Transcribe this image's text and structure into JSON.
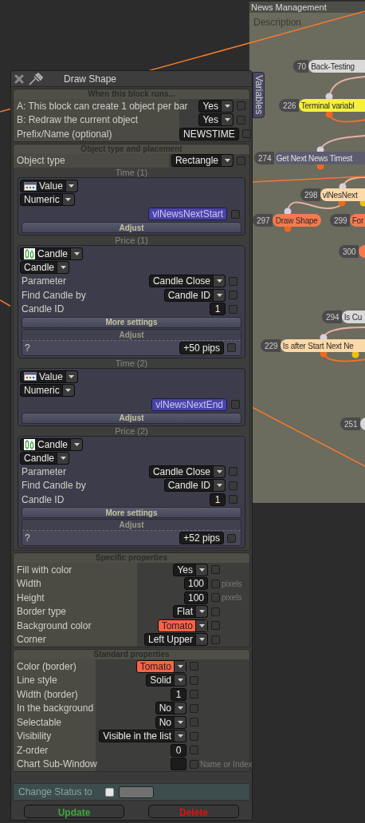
{
  "news_panel": {
    "title": "News Management",
    "description": "Description",
    "side_tab": "Variables",
    "nodes": [
      {
        "id": "70",
        "label": "Back-Testing",
        "color": "#d9d9d9"
      },
      {
        "id": "226",
        "label": "Terminal variabl",
        "color": "#f5f03c"
      },
      {
        "id": "274",
        "label": "Get Next News Timest",
        "color": "#5c5c6e"
      },
      {
        "id": "298",
        "label": "vlNesNext",
        "color": "#fcd9a8"
      },
      {
        "id": "297",
        "label": "Draw Shape",
        "color": "#f57a4f"
      },
      {
        "id": "299",
        "label": "For",
        "color": "#f57a4f"
      },
      {
        "id": "300",
        "color": "#f57a4f"
      },
      {
        "id": "294",
        "label": "Is Cu",
        "color": "#d9d9d9"
      },
      {
        "id": "229",
        "label": "Is after Start Next Ne",
        "color": "#fcd9a8"
      },
      {
        "id": "251",
        "color": "#d9d9d9"
      }
    ]
  },
  "dialog": {
    "title": "Draw Shape",
    "sections": [
      {
        "kind": "runs",
        "title": "When this block runs...",
        "rows": [
          {
            "kind": "dropdown",
            "label": "A: This block can create 1 object per bar",
            "value": "Yes",
            "checked": false
          },
          {
            "kind": "dropdown",
            "label": "B: Redraw the current object",
            "value": "Yes",
            "checked": false
          },
          {
            "kind": "text",
            "label": "Prefix/Name (optional)",
            "value": "NEWSTIME",
            "checked": false
          }
        ]
      },
      {
        "kind": "placement",
        "title": "Object type and placement",
        "rows": [
          {
            "kind": "dropdown",
            "label": "Object type",
            "value": "Rectangle",
            "checked": false
          }
        ],
        "groups": [
          {
            "kind": "value",
            "title": "Time (1)",
            "source": "Value",
            "type": "Numeric",
            "variable": "vlNewsNextStart",
            "checked": false,
            "adjust": "Adjust"
          },
          {
            "kind": "candle",
            "title": "Price (1)",
            "source": "Candle",
            "type": "Candle",
            "rows": [
              {
                "kind": "dropdown",
                "label": "Parameter",
                "value": "Candle Close",
                "checked": false
              },
              {
                "kind": "dropdown",
                "label": "Find Candle by",
                "value": "Candle ID",
                "checked": false
              },
              {
                "kind": "text",
                "label": "Candle ID",
                "value": "1",
                "checked": false
              }
            ],
            "more": "More settings",
            "adjust": "Adjust",
            "adjust_row": {
              "label": "?",
              "value": "+50 pips",
              "checked": false
            }
          },
          {
            "kind": "value",
            "title": "Time (2)",
            "source": "Value",
            "type": "Numeric",
            "variable": "vlNewsNextEnd",
            "checked": false,
            "adjust": "Adjust"
          },
          {
            "kind": "candle",
            "title": "Price (2)",
            "source": "Candle",
            "type": "Candle",
            "rows": [
              {
                "kind": "dropdown",
                "label": "Parameter",
                "value": "Candle Close",
                "checked": false
              },
              {
                "kind": "dropdown",
                "label": "Find Candle by",
                "value": "Candle ID",
                "checked": false
              },
              {
                "kind": "text",
                "label": "Candle ID",
                "value": "1",
                "checked": false
              }
            ],
            "more": "More settings",
            "adjust": "Adjust",
            "adjust_row": {
              "label": "?",
              "value": "+52 pips",
              "checked": false
            }
          }
        ]
      },
      {
        "kind": "specific",
        "title": "Specific properties",
        "rows": [
          {
            "kind": "dropdown",
            "label": "Fill with color",
            "value": "Yes",
            "checked": false
          },
          {
            "kind": "text",
            "label": "Width",
            "value": "100",
            "checked": false,
            "unit": "pixels"
          },
          {
            "kind": "text",
            "label": "Height",
            "value": "100",
            "checked": false,
            "unit": "pixels"
          },
          {
            "kind": "dropdown",
            "label": "Border type",
            "value": "Flat",
            "checked": false
          },
          {
            "kind": "dropdown",
            "label": "Background color",
            "value": "Tomato",
            "color": "#ff6347",
            "checked": false
          },
          {
            "kind": "dropdown",
            "label": "Corner",
            "value": "Left Upper",
            "checked": false
          }
        ]
      },
      {
        "kind": "standard",
        "title": "Standard properties",
        "rows": [
          {
            "kind": "dropdown",
            "label": "Color (border)",
            "value": "Tomato",
            "color": "#ff6347",
            "checked": false
          },
          {
            "kind": "dropdown",
            "label": "Line style",
            "value": "Solid",
            "checked": false
          },
          {
            "kind": "text",
            "label": "Width (border)",
            "value": "1",
            "checked": false
          },
          {
            "kind": "dropdown",
            "label": "In the background",
            "value": "No",
            "checked": false
          },
          {
            "kind": "dropdown",
            "label": "Selectable",
            "value": "No",
            "checked": false
          },
          {
            "kind": "dropdown",
            "label": "Visibility",
            "value": "Visible in the list",
            "checked": false
          },
          {
            "kind": "text",
            "label": "Z-order",
            "value": "0",
            "checked": false
          },
          {
            "kind": "text",
            "label": "Chart Sub-Window",
            "checked": false,
            "unit": "Name or Index"
          }
        ]
      }
    ],
    "status": {
      "label": "Change Status to",
      "checked": false
    },
    "buttons": [
      {
        "kind": "update",
        "label": "Update"
      },
      {
        "kind": "delete",
        "label": "Delete"
      }
    ]
  }
}
